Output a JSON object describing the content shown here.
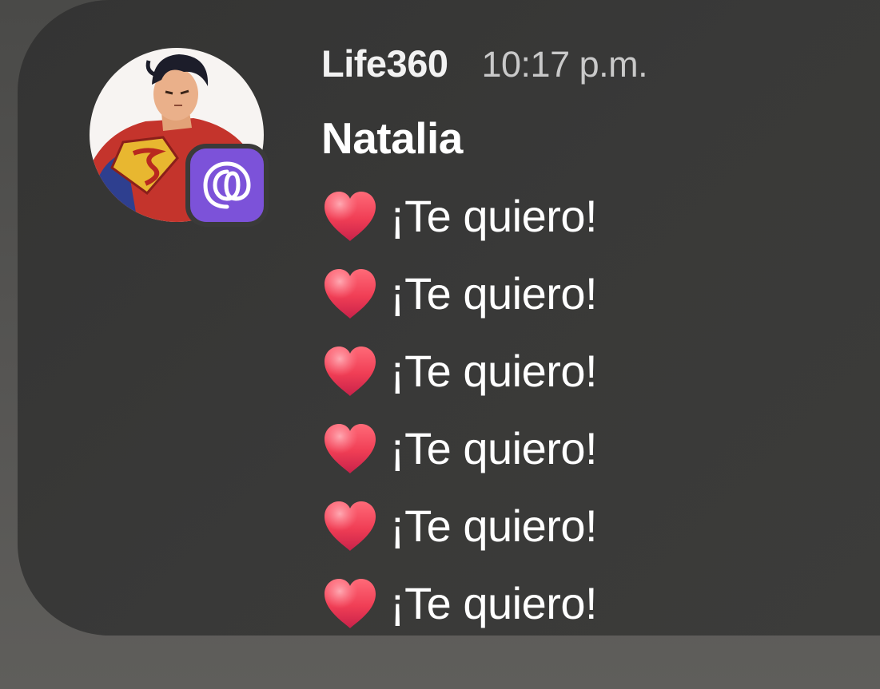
{
  "notification": {
    "app_name": "Life360",
    "time": "10:17 p.m.",
    "sender": "Natalia",
    "app_icon": "life360-icon",
    "avatar_icon": "contact-avatar",
    "accent_color": "#7c52d9",
    "messages": [
      {
        "emoji": "red-heart-icon",
        "text": "¡Te quiero!"
      },
      {
        "emoji": "red-heart-icon",
        "text": "¡Te quiero!"
      },
      {
        "emoji": "red-heart-icon",
        "text": "¡Te quiero!"
      },
      {
        "emoji": "red-heart-icon",
        "text": "¡Te quiero!"
      },
      {
        "emoji": "red-heart-icon",
        "text": "¡Te quiero!"
      },
      {
        "emoji": "red-heart-icon",
        "text": "¡Te quiero!"
      }
    ]
  }
}
